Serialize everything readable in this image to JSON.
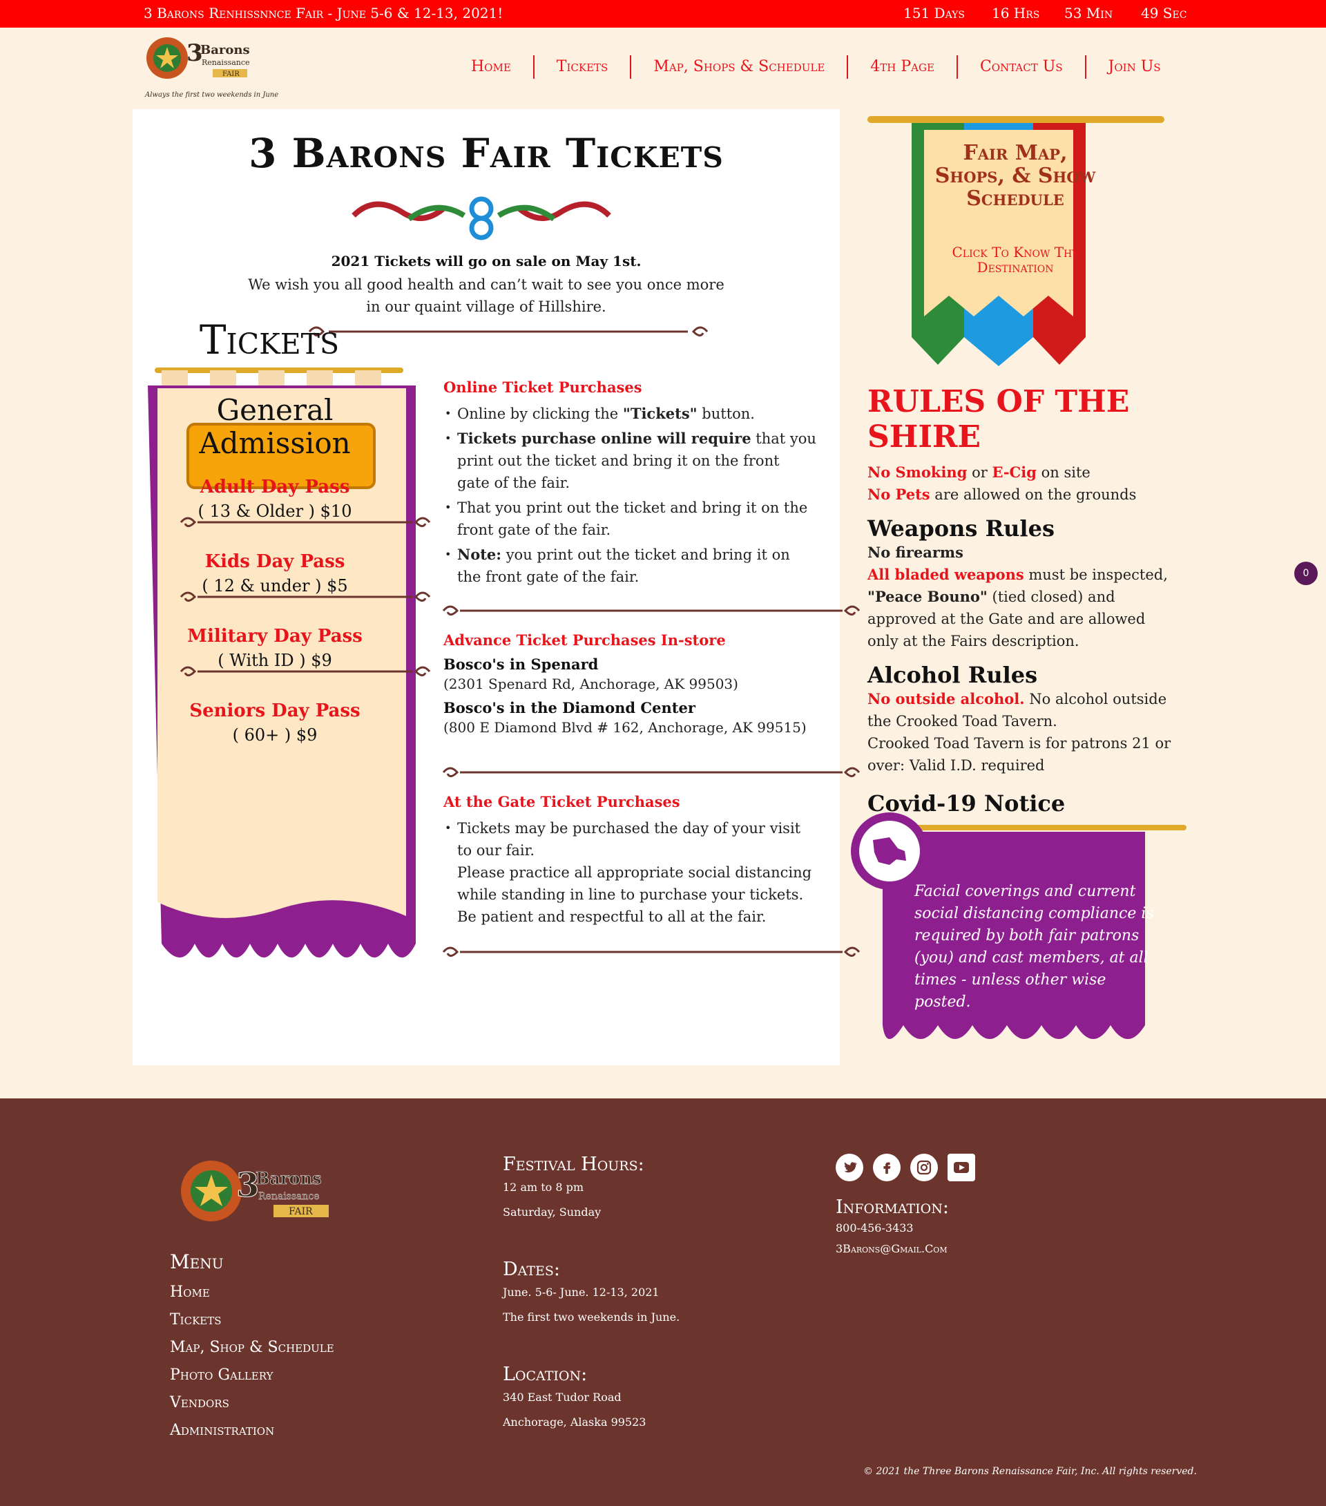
{
  "topbar": {
    "title": "3 Barons Renhissnnce Fair - June 5-6 & 12-13, 2021!",
    "days": "151 Days",
    "hrs": "16 Hrs",
    "min": "53 Min",
    "sec": "49 Sec"
  },
  "logo": {
    "tagline": "Always the first two weekends in June"
  },
  "nav": [
    "Home",
    "Tickets",
    "Map, Shops  &  Schedule",
    "4th Page",
    "Contact Us",
    "Join Us"
  ],
  "main": {
    "title": "3 Barons Fair Tickets",
    "sale": "2021 Tickets will go on sale on May 1st.",
    "wish": "We wish you all good health and can’t wait to see you once more in our quaint village of Hillshire."
  },
  "tickets": {
    "badge": "Tickets",
    "ga": "General Admission",
    "passes": [
      {
        "name": "Adult Day Pass",
        "price": "( 13 & Older ) $10"
      },
      {
        "name": "Kids Day Pass",
        "price": "( 12 & under ) $5"
      },
      {
        "name": "Military Day Pass",
        "price": "( With ID ) $9"
      },
      {
        "name": "Seniors Day Pass",
        "price": "( 60+ ) $9"
      }
    ]
  },
  "online": {
    "heading": "Online Ticket Purchases",
    "b1_pre": "Online by clicking the ",
    "b1_bold": "\"Tickets\"",
    "b1_post": " button.",
    "b2_bold": "Tickets purchase online will require",
    "b2_post": " that you print out the ticket and bring it on the front gate of the fair.",
    "b3": "That you print out the ticket and bring it on the front gate of the fair.",
    "b4_bold": "Note:",
    "b4_post": " you print out the ticket and bring it on the front gate of the fair."
  },
  "advance": {
    "heading": "Advance Ticket Purchases In-store",
    "store1": "Bosco's in Spenard",
    "addr1": "(2301 Spenard Rd, Anchorage, AK 99503)",
    "store2": "Bosco's in the Diamond Center",
    "addr2": "(800 E Diamond Blvd # 162, Anchorage, AK 99515)"
  },
  "gate": {
    "heading": "At the Gate Ticket Purchases",
    "b1": "Tickets may be purchased the day of your visit to our fair.",
    "b1b": "Please practice all appropriate social distancing while standing in line to purchase your tickets. Be patient and respectful to all at the fair."
  },
  "flag": {
    "title": "Fair Map, Shops, & Show Schedule",
    "sub": "Click To Know Thy Destination"
  },
  "rules": {
    "heading": "RULES OF THE SHIRE",
    "r1_a": "No Smoking",
    "r1_b": " or ",
    "r1_c": "E-Cig",
    "r1_d": " on site",
    "r2_a": "No Pets",
    "r2_b": " are allowed on the grounds",
    "weapons_h": "Weapons Rules",
    "w1": "No firearms",
    "w2_a": "All bladed weapons",
    "w2_b": " must be inspected, ",
    "w2_c": "\"Peace Bouno\"",
    "w2_d": " (tied closed) and approved at the Gate and are allowed only at the Fairs description.",
    "alcohol_h": "Alcohol Rules",
    "a1_a": "No outside alcohol.",
    "a1_b": " No alcohol outside the Crooked Toad Tavern.",
    "a2": "Crooked Toad Tavern is for patrons 21 or over: Valid I.D. required",
    "covid_h": "Covid-19 Notice",
    "covid": "Facial coverings and current social distancing compliance is required by both fair patrons (you) and cast members, at all times - unless other wise posted."
  },
  "cart_count": "0",
  "footer": {
    "menu_h": "Menu",
    "menu": [
      "Home",
      "Tickets",
      "Map, Shop & Schedule",
      "Photo Gallery",
      "Vendors",
      "Administration"
    ],
    "hours_h": "Festival Hours:",
    "hours1": "12 am to 8 pm",
    "hours2": "Saturday, Sunday",
    "dates_h": "Dates:",
    "dates1": "June. 5-6- June. 12-13, 2021",
    "dates2": "The first two weekends in June.",
    "loc_h": "Location:",
    "loc1": "340 East Tudor Road",
    "loc2": "Anchorage, Alaska 99523",
    "info_h": "Information:",
    "phone": "800-456-3433",
    "email": "3Barons@Gmail.Com",
    "copyright": "© 2021 the Three Barons Renaissance Fair, Inc. All rights reserved."
  },
  "colors": {
    "red": "#e8141c",
    "purple": "#8e1f8e",
    "footer": "#6b342c",
    "cream": "#fdf1e1"
  }
}
